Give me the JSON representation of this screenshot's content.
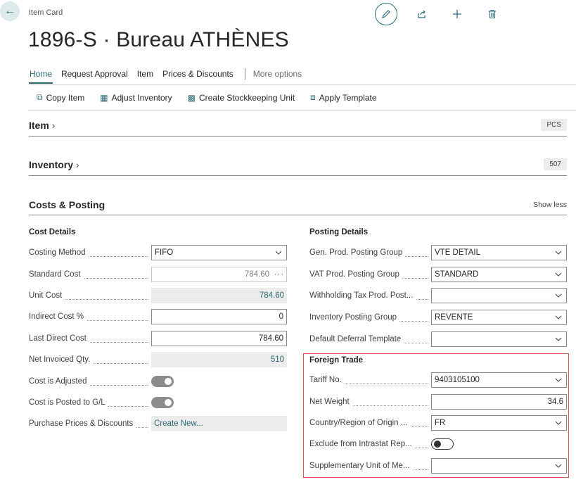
{
  "header": {
    "breadcrumb": "Item Card",
    "title": "1896-S · Bureau ATHÈNES"
  },
  "tabs": [
    {
      "label": "Home",
      "active": true
    },
    {
      "label": "Request Approval"
    },
    {
      "label": "Item"
    },
    {
      "label": "Prices & Discounts"
    },
    {
      "label": "More options"
    }
  ],
  "actions": {
    "copy_item": "Copy Item",
    "adjust_inventory": "Adjust Inventory",
    "create_sku": "Create Stockkeeping Unit",
    "apply_template": "Apply Template"
  },
  "fasttabs": {
    "item": {
      "title": "Item",
      "badge": "PCS"
    },
    "inventory": {
      "title": "Inventory",
      "badge": "507"
    },
    "costs": {
      "title": "Costs & Posting",
      "toggle": "Show less"
    }
  },
  "cost_details": {
    "title": "Cost Details",
    "costing_method": {
      "label": "Costing Method",
      "value": "FIFO"
    },
    "standard_cost": {
      "label": "Standard Cost",
      "value": "784.60"
    },
    "unit_cost": {
      "label": "Unit Cost",
      "value": "784.60"
    },
    "indirect_cost": {
      "label": "Indirect Cost %",
      "value": "0"
    },
    "last_direct_cost": {
      "label": "Last Direct Cost",
      "value": "784.60"
    },
    "net_invoiced_qty": {
      "label": "Net Invoiced Qty.",
      "value": "510"
    },
    "cost_is_adjusted": {
      "label": "Cost is Adjusted",
      "value": true
    },
    "cost_posted_gl": {
      "label": "Cost is Posted to G/L",
      "value": true
    },
    "purchase_prices": {
      "label": "Purchase Prices & Discounts",
      "value": "Create New..."
    }
  },
  "posting_details": {
    "title": "Posting Details",
    "gen_prod": {
      "label": "Gen. Prod. Posting Group",
      "value": "VTE DÉTAIL"
    },
    "vat_prod": {
      "label": "VAT Prod. Posting Group",
      "value": "STANDARD"
    },
    "withholding": {
      "label": "Withholding Tax Prod. Post...",
      "value": ""
    },
    "inventory_posting": {
      "label": "Inventory Posting Group",
      "value": "REVENTE"
    },
    "deferral": {
      "label": "Default Deferral Template",
      "value": ""
    }
  },
  "foreign_trade": {
    "title": "Foreign Trade",
    "tariff": {
      "label": "Tariff No.",
      "value": "9403105100"
    },
    "net_weight": {
      "label": "Net Weight",
      "value": "34.6"
    },
    "country": {
      "label": "Country/Region of Origin ...",
      "value": "FR"
    },
    "exclude_intrastat": {
      "label": "Exclude from Intrastat Rep...",
      "value": false
    },
    "supp_unit": {
      "label": "Supplementary Unit of Me...",
      "value": ""
    }
  }
}
